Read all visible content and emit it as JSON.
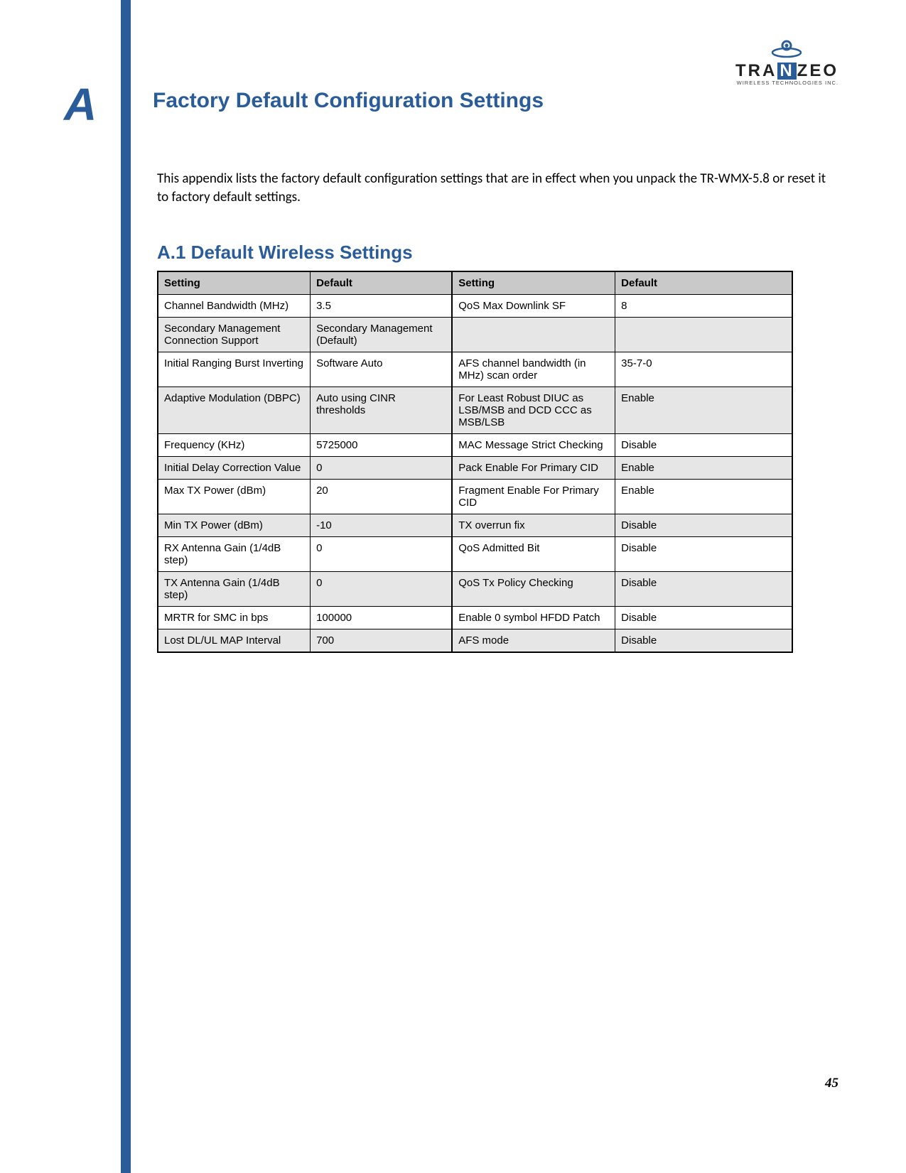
{
  "appendix_letter": "A",
  "logo": {
    "brand_plain1": "TRA",
    "brand_box": "N",
    "brand_plain2": "ZEO",
    "tagline": "WIRELESS  TECHNOLOGIES INC."
  },
  "title": "Factory Default Configuration Settings",
  "intro": "This appendix lists the factory default configuration settings that are in effect when you unpack the TR-WMX-5.8 or reset it to factory default settings.",
  "section_heading": "A.1 Default Wireless Settings",
  "table": {
    "headers": [
      "Setting",
      "Default",
      "Setting",
      "Default"
    ],
    "rows": [
      {
        "shade": "B",
        "c": [
          "Channel Bandwidth (MHz)",
          "3.5",
          "QoS Max Downlink SF",
          "8"
        ]
      },
      {
        "shade": "A",
        "c": [
          "Secondary Management Connection Support",
          "Secondary Management (Default)",
          "",
          ""
        ]
      },
      {
        "shade": "B",
        "c": [
          "Initial Ranging Burst Inverting",
          "Software Auto",
          "AFS channel bandwidth (in MHz) scan order",
          "35-7-0"
        ]
      },
      {
        "shade": "A",
        "c": [
          "Adaptive Modulation (DBPC)",
          "Auto using CINR thresholds",
          "For Least Robust DIUC as LSB/MSB and DCD CCC as MSB/LSB",
          "Enable"
        ]
      },
      {
        "shade": "B",
        "c": [
          "Frequency (KHz)",
          "5725000",
          "MAC Message Strict Checking",
          "Disable"
        ]
      },
      {
        "shade": "A",
        "c": [
          "Initial Delay Correction Value",
          "0",
          "Pack Enable For Primary CID",
          "Enable"
        ]
      },
      {
        "shade": "B",
        "c": [
          "Max TX Power (dBm)",
          "20",
          "Fragment Enable For Primary CID",
          "Enable"
        ]
      },
      {
        "shade": "A",
        "c": [
          "Min TX Power (dBm)",
          "-10",
          "TX overrun fix",
          "Disable"
        ]
      },
      {
        "shade": "B",
        "c": [
          "RX Antenna Gain (1/4dB step)",
          "0",
          "QoS Admitted Bit",
          "Disable"
        ]
      },
      {
        "shade": "A",
        "c": [
          "TX Antenna Gain (1/4dB step)",
          "0",
          "QoS Tx Policy Checking",
          "Disable"
        ]
      },
      {
        "shade": "B",
        "c": [
          "MRTR for SMC in bps",
          "100000",
          "Enable 0 symbol HFDD Patch",
          "Disable"
        ]
      },
      {
        "shade": "A",
        "c": [
          "Lost DL/UL MAP Interval",
          "700",
          "AFS mode",
          "Disable"
        ]
      }
    ]
  },
  "page_number": "45"
}
